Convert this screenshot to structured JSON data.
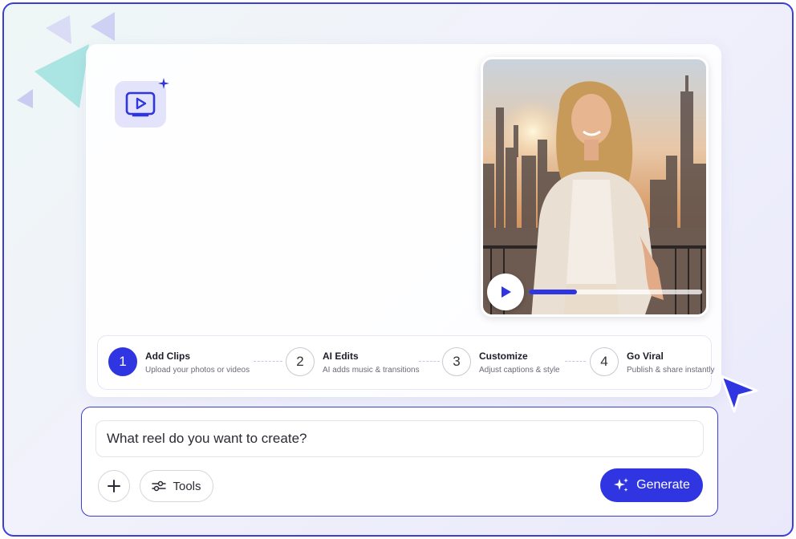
{
  "hero": {
    "app_icon": "video-play-icon",
    "video": {
      "progress": 0.28
    }
  },
  "steps": [
    {
      "number": "1",
      "title": "Add Clips",
      "description": "Upload your photos or videos",
      "active": true
    },
    {
      "number": "2",
      "title": "AI Edits",
      "description": "AI adds music & transitions",
      "active": false
    },
    {
      "number": "3",
      "title": "Customize",
      "description": "Adjust captions & style",
      "active": false
    },
    {
      "number": "4",
      "title": "Go Viral",
      "description": "Publish & share instantly",
      "active": false
    }
  ],
  "prompt": {
    "placeholder": "What reel do you want to create?",
    "value": "",
    "tools_label": "Tools",
    "generate_label": "Generate"
  },
  "colors": {
    "accent": "#2f35e0",
    "frame_border": "#3b3fd8"
  }
}
